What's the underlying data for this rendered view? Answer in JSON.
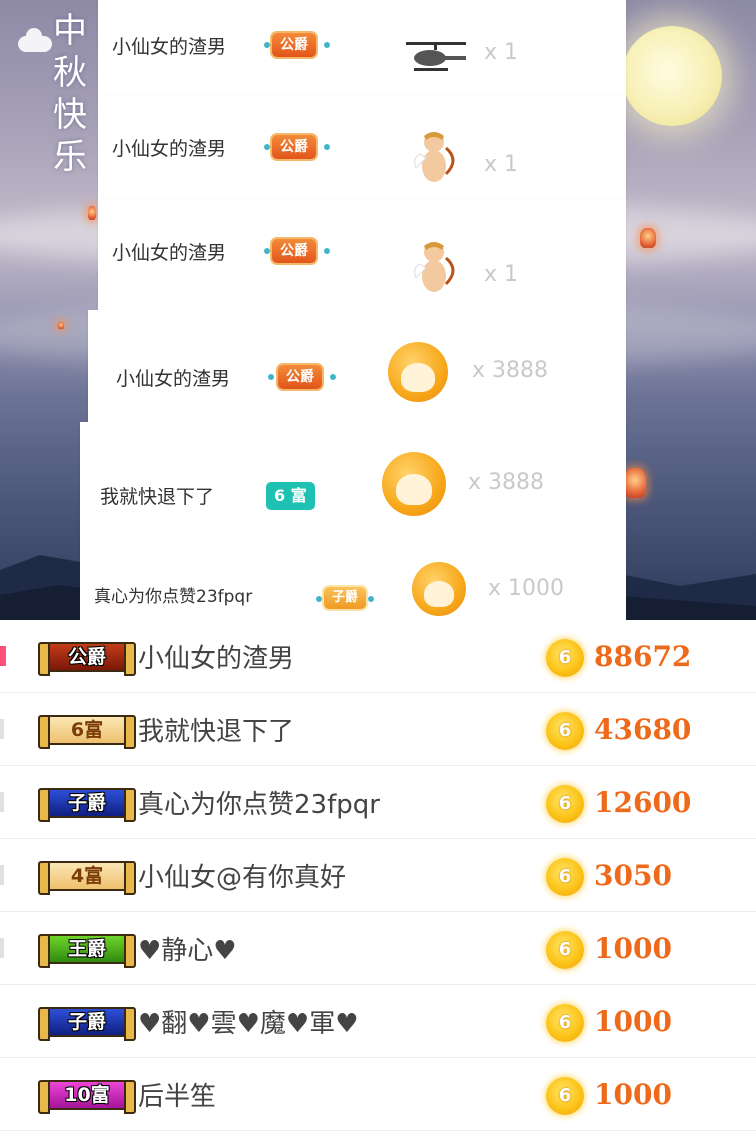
{
  "background": {
    "festival_text": [
      "中",
      "秋",
      "快",
      "乐"
    ]
  },
  "gift_feed": [
    {
      "name": "小仙女的渣男",
      "badge": "公爵",
      "badge_type": "duke",
      "gift_icon": "helicopter-icon",
      "count": "x 1"
    },
    {
      "name": "小仙女的渣男",
      "badge": "公爵",
      "badge_type": "duke",
      "gift_icon": "cupid-icon",
      "count": "x 1"
    },
    {
      "name": "小仙女的渣男",
      "badge": "公爵",
      "badge_type": "duke",
      "gift_icon": "cupid-icon",
      "count": "x 1"
    },
    {
      "name": "小仙女的渣男",
      "badge": "公爵",
      "badge_type": "duke",
      "gift_icon": "coin-avatar-icon",
      "count": "x 3888"
    },
    {
      "name": "我就快退下了",
      "badge": "6 富",
      "badge_type": "rich",
      "gift_icon": "coin-avatar-icon",
      "count": "x 3888"
    },
    {
      "name": "真心为你点赞23fpqr",
      "badge": "子爵",
      "badge_type": "viscount",
      "gift_icon": "coin-avatar-icon",
      "count": "x 1000"
    }
  ],
  "leaderboard": [
    {
      "badge": "公爵",
      "badge_type": "duke",
      "name": "小仙女的渣男",
      "coin": "6",
      "score": "88672"
    },
    {
      "badge": "6富",
      "badge_type": "rich",
      "name": "我就快退下了",
      "coin": "6",
      "score": "43680"
    },
    {
      "badge": "子爵",
      "badge_type": "viscount",
      "name": "真心为你点赞23fpqr",
      "coin": "6",
      "score": "12600"
    },
    {
      "badge": "4富",
      "badge_type": "rich",
      "name": "小仙女@有你真好",
      "coin": "6",
      "score": "3050"
    },
    {
      "badge": "王爵",
      "badge_type": "king",
      "name": "♥静心♥",
      "coin": "6",
      "score": "1000"
    },
    {
      "badge": "子爵",
      "badge_type": "viscount",
      "name": "♥翻♥雲♥魔♥軍♥",
      "coin": "6",
      "score": "1000"
    },
    {
      "badge": "10富",
      "badge_type": "rich10",
      "name": "后半笙",
      "coin": "6",
      "score": "1000"
    }
  ],
  "colors": {
    "score": "#ee6a1a",
    "rank1_marker": "#ff4f7b",
    "coin": "#fcc419"
  }
}
